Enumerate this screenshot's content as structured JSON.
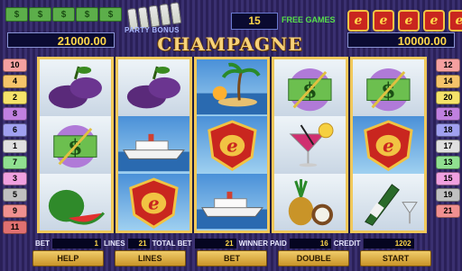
{
  "money_icons": [
    "$",
    "$",
    "$",
    "$",
    "$"
  ],
  "party_bonus_label": "PARTY BONUS",
  "free_games": {
    "count": "15",
    "label": "FREE GAMES"
  },
  "e_icons": [
    "e",
    "e",
    "e",
    "e",
    "e"
  ],
  "left_amount": "21000.00",
  "right_amount": "10000.00",
  "title": "CHAMPAGNE",
  "lines_left": [
    "10",
    "4",
    "2",
    "8",
    "6",
    "1",
    "7",
    "3",
    "5",
    "9",
    "11"
  ],
  "lines_right": [
    "12",
    "14",
    "20",
    "16",
    "18",
    "17",
    "13",
    "15",
    "19",
    "21"
  ],
  "reels": [
    [
      "plum",
      "dollar",
      "watermelon"
    ],
    [
      "plum",
      "ship",
      "e-badge"
    ],
    [
      "island",
      "e-badge",
      "ship"
    ],
    [
      "dollar",
      "cocktail",
      "pineapple"
    ],
    [
      "dollar",
      "e-badge",
      "champagne"
    ]
  ],
  "stats": {
    "bet_label": "BET",
    "bet_value": "1",
    "lines_label": "LINES",
    "lines_value": "21",
    "total_bet_label": "TOTAL BET",
    "total_bet_value": "21",
    "winner_paid_label": "WINNER PAID",
    "winner_paid_value": "16",
    "credit_label": "CREDIT",
    "credit_value": "1202"
  },
  "buttons": {
    "help": "HELP",
    "lines": "LINES",
    "bet": "BET",
    "double": "DOUBLE",
    "start": "START"
  },
  "colors": {
    "reel_border": "#f0c85a",
    "value_text": "#ffd84a",
    "free_games_label": "#57e04a"
  }
}
